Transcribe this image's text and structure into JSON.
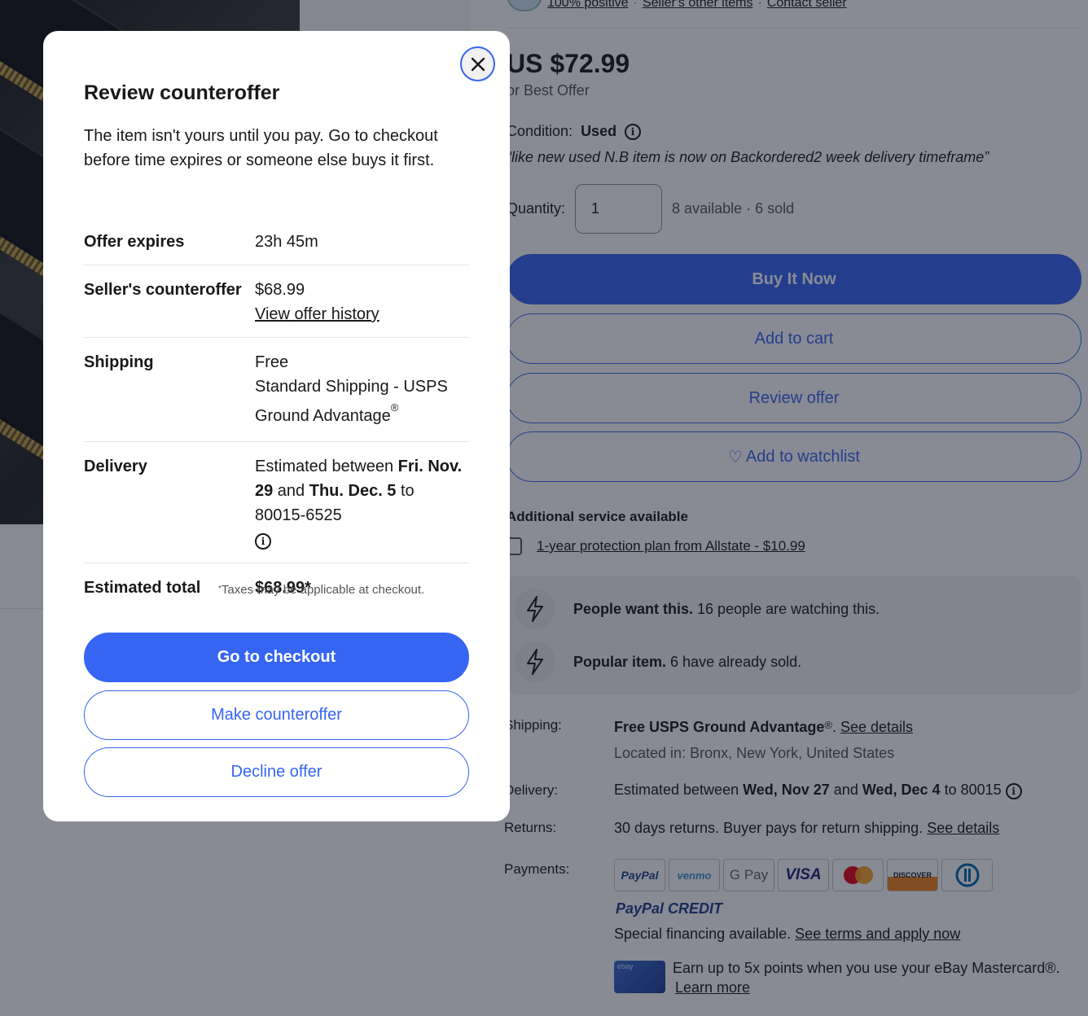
{
  "background": {
    "seller": {
      "positive": "100% positive",
      "other_items": "Seller's other items",
      "contact": "Contact seller"
    },
    "price": "US $72.99",
    "best_offer": "or Best Offer",
    "condition_label": "Condition:",
    "condition_value": "Used",
    "condition_note": "“like new used N.B item is now on Backordered2 week delivery timeframe”",
    "quantity_label": "Quantity:",
    "quantity_value": "1",
    "availability": "8 available · 6 sold",
    "buttons": {
      "buy_now": "Buy It Now",
      "add_to_cart": "Add to cart",
      "review_offer": "Review offer",
      "watchlist": "Add to watchlist"
    },
    "additional_service": "Additional service available",
    "protection_plan": "1-year protection plan from Allstate - $10.99",
    "signals": [
      {
        "bold": "People want this.",
        "text": " 16 people are watching this."
      },
      {
        "bold": "Popular item.",
        "text": " 6 have already sold."
      }
    ],
    "shipping": {
      "label": "Shipping:",
      "value": "Free USPS Ground Advantage",
      "link": "See details",
      "location": "Located in: Bronx, New York, United States"
    },
    "delivery": {
      "label": "Delivery:",
      "prefix": "Estimated between ",
      "date1": "Wed, Nov 27",
      "and": " and ",
      "date2": "Wed, Dec 4",
      "suffix": " to 80015"
    },
    "returns": {
      "label": "Returns:",
      "value": "30 days returns. Buyer pays for return shipping.",
      "link": "See details"
    },
    "payments": {
      "label": "Payments:",
      "logos": [
        "PayPal",
        "venmo",
        "G Pay",
        "VISA",
        "",
        "DISCOVER",
        ""
      ],
      "paypal_credit": "PayPal CREDIT",
      "financing": "Special financing available.",
      "financing_link": "See terms and apply now",
      "mastercard_text": "Earn up to 5x points when you use your eBay Mastercard®.",
      "learn_more": "Learn more",
      "card_brand": "ebay"
    }
  },
  "modal": {
    "title": "Review counteroffer",
    "description": "The item isn't yours until you pay. Go to checkout before time expires or someone else buys it first.",
    "rows": {
      "expires": {
        "label": "Offer expires",
        "value": "23h 45m"
      },
      "counteroffer": {
        "label": "Seller's counteroffer",
        "value": "$68.99",
        "link": "View offer history"
      },
      "shipping": {
        "label": "Shipping",
        "line1": "Free",
        "line2": "Standard Shipping - USPS Ground Advantage"
      },
      "delivery": {
        "label": "Delivery",
        "prefix": "Estimated between ",
        "date1": "Fri. Nov. 29",
        "and": " and ",
        "date2": "Thu. Dec. 5",
        "suffix": " to 80015-6525"
      },
      "total": {
        "label": "Estimated total",
        "value": "$68.99*"
      }
    },
    "tax_note": "Taxes may be applicable at checkout.",
    "buttons": {
      "checkout": "Go to checkout",
      "counteroffer": "Make counteroffer",
      "decline": "Decline offer"
    }
  },
  "colors": {
    "accent": "#3665f3",
    "overlay": "#111827"
  }
}
